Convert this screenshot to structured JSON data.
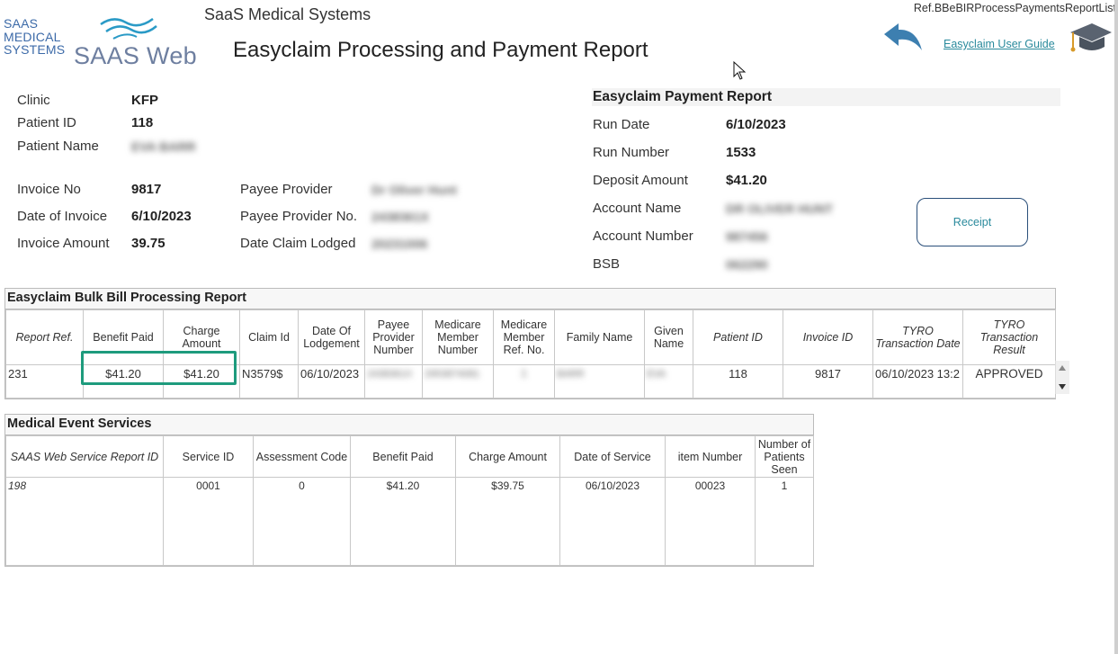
{
  "header": {
    "logo_line1": "SAAS",
    "logo_line2": "MEDICAL",
    "logo_line3": "SYSTEMS",
    "logo_product": "SAAS Web",
    "company": "SaaS Medical Systems",
    "title": "Easyclaim Processing and Payment Report",
    "ref_path": "Ref.BBeBIRProcessPaymentsReportList",
    "guide_link": "Easyclaim User Guide",
    "icons": [
      "back-arrow-icon",
      "graduation-cap-icon",
      "mouse-cursor-icon"
    ]
  },
  "patient": {
    "clinic_label": "Clinic",
    "clinic": "KFP",
    "patient_id_label": "Patient ID",
    "patient_id": "118",
    "patient_name_label": "Patient Name",
    "patient_name": "EVA BARR"
  },
  "invoice": {
    "invoice_no_label": "Invoice No",
    "invoice_no": "9817",
    "date_label": "Date of Invoice",
    "date": "6/10/2023",
    "amount_label": "Invoice Amount",
    "amount": "39.75",
    "payee_label": "Payee Provider",
    "payee": "Dr Oliver Hunt",
    "payee_no_label": "Payee Provider No.",
    "payee_no": "2438361X",
    "lodged_label": "Date Claim Lodged",
    "lodged": "20231006"
  },
  "payment": {
    "heading": "Easyclaim Payment Report",
    "run_date_label": "Run Date",
    "run_date": "6/10/2023",
    "run_number_label": "Run Number",
    "run_number": "1533",
    "deposit_label": "Deposit Amount",
    "deposit": "$41.20",
    "account_name_label": "Account Name",
    "account_name": "DR OLIVER HUNT",
    "account_number_label": "Account Number",
    "account_number": "987456",
    "bsb_label": "BSB",
    "bsb": "062290",
    "receipt_button": "Receipt"
  },
  "bulk": {
    "title": "Easyclaim Bulk Bill Processing Report",
    "headers": [
      "Report Ref.",
      "Benefit Paid",
      "Charge Amount",
      "Claim Id",
      "Date Of Lodgement",
      "Payee Provider Number",
      "Medicare Member Number",
      "Medicare Member Ref. No.",
      "Family Name",
      "Given Name",
      "Patient ID",
      "Invoice ID",
      "TYRO Transaction Date",
      "TYRO Transaction Result"
    ],
    "row": [
      "231",
      "$41.20",
      "$41.20",
      "N3579$",
      "06/10/2023",
      "2438361X",
      "2953874081",
      "1",
      "BARR",
      "EVA",
      "118",
      "9817",
      "06/10/2023 13:2",
      "APPROVED"
    ]
  },
  "services": {
    "title": "Medical Event Services",
    "headers": [
      "SAAS Web Service Report ID",
      "Service ID",
      "Assessment Code",
      "Benefit Paid",
      "Charge Amount",
      "Date of Service",
      "item Number",
      "Number of Patients Seen"
    ],
    "row": [
      "198",
      "0001",
      "0",
      "$41.20",
      "$39.75",
      "06/10/2023",
      "00023",
      "1"
    ]
  },
  "colors": {
    "accent_teal": "#1e9b7d",
    "link": "#2a8a9c",
    "logo_blue": "#3c6aa8"
  }
}
